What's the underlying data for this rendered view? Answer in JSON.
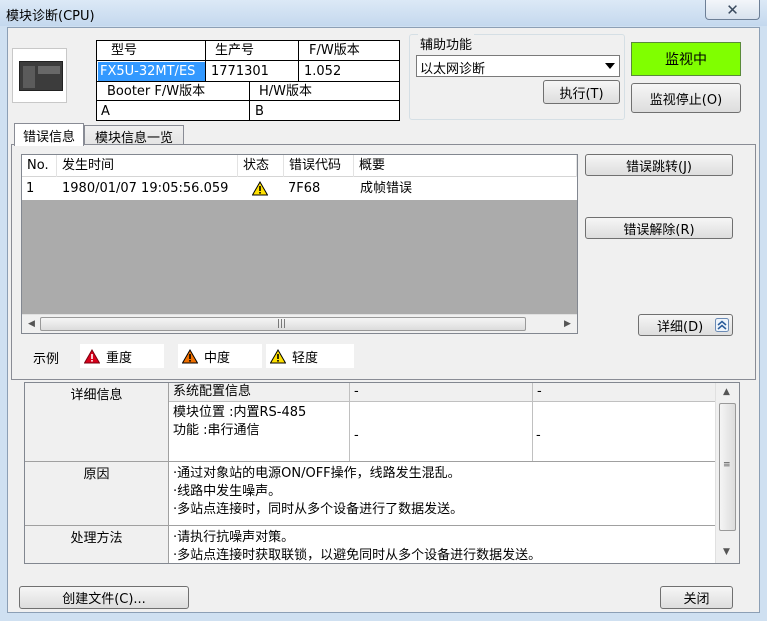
{
  "window": {
    "title": "模块诊断(CPU)",
    "close_glyph": "✕"
  },
  "model_info": {
    "model_header": "型号",
    "serial_header": "生产号",
    "fw_header": "F/W版本",
    "model_value": "FX5U-32MT/ES",
    "serial_value": "1771301",
    "fw_value": "1.052",
    "booter_header": "Booter F/W版本",
    "hw_header": "H/W版本",
    "booter_value": "A",
    "hw_value": "B"
  },
  "aux": {
    "label": "辅助功能",
    "selected": "以太网诊断",
    "execute_button": "执行(T)"
  },
  "monitor": {
    "status": "监视中",
    "stop_button": "监视停止(O)"
  },
  "tabs": [
    {
      "label": "错误信息",
      "active": true
    },
    {
      "label": "模块信息一览",
      "active": false
    }
  ],
  "error_list": {
    "columns": [
      "No.",
      "发生时间",
      "状态",
      "错误代码",
      "概要"
    ],
    "rows": [
      {
        "no": "1",
        "time": "1980/01/07 19:05:56.059",
        "status_icon": "warning-minor-icon",
        "code": "7F68",
        "summary": "成帧错误"
      }
    ]
  },
  "buttons": {
    "error_jump": "错误跳转(J)",
    "error_clear": "错误解除(R)",
    "detail": "详细(D)",
    "create_file": "创建文件(C)...",
    "close": "关闭"
  },
  "legend": {
    "label": "示例",
    "major": "重度",
    "moderate": "中度",
    "minor": "轻度"
  },
  "colors": {
    "major": "#d8001a",
    "moderate": "#f07000",
    "minor": "#ffe000",
    "monitor_active": "#80ff00",
    "selection": "#3399ff"
  },
  "detail_table": {
    "detail_label": "详细信息",
    "col1_header": "系统配置信息",
    "col2_header": "-",
    "col3_header": "-",
    "info_line1": "模块位置 :内置RS-485",
    "info_line2": "功能 :串行通信",
    "col2_value": "-",
    "col3_value": "-",
    "cause_label": "原因",
    "cause_line1": "·通过对象站的电源ON/OFF操作，线路发生混乱。",
    "cause_line2": "·线路中发生噪声。",
    "cause_line3": "·多站点连接时，同时从多个设备进行了数据发送。",
    "action_label": "处理方法",
    "action_line1": "·请执行抗噪声对策。",
    "action_line2": "·多站点连接时获取联锁，以避免同时从多个设备进行数据发送。"
  }
}
